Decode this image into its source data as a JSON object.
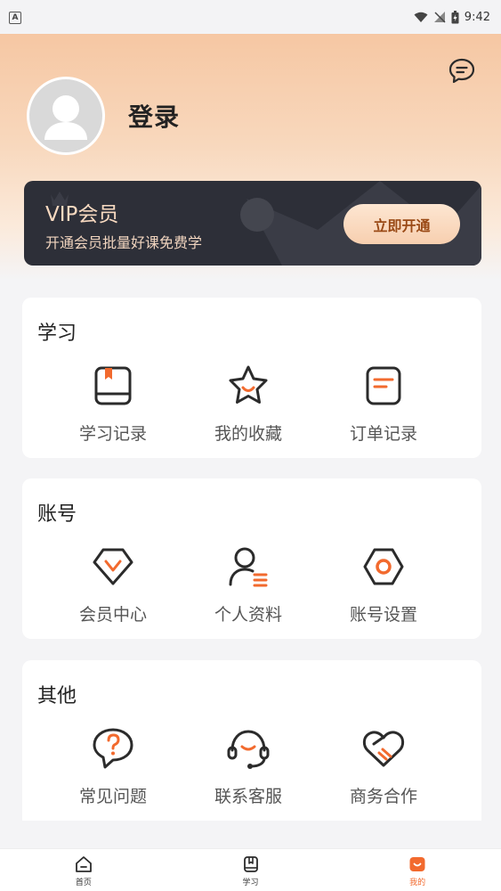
{
  "status_bar": {
    "app_badge": "A",
    "time": "9:42"
  },
  "profile": {
    "login_label": "登录"
  },
  "vip": {
    "title": "VIP会员",
    "subtitle": "开通会员批量好课免费学",
    "button": "立即开通"
  },
  "sections": [
    {
      "title": "学习",
      "items": [
        {
          "label": "学习记录",
          "icon": "book-icon"
        },
        {
          "label": "我的收藏",
          "icon": "star-icon"
        },
        {
          "label": "订单记录",
          "icon": "order-icon"
        }
      ]
    },
    {
      "title": "账号",
      "items": [
        {
          "label": "会员中心",
          "icon": "vip-diamond-icon"
        },
        {
          "label": "个人资料",
          "icon": "profile-icon"
        },
        {
          "label": "账号设置",
          "icon": "settings-hexagon-icon"
        }
      ]
    },
    {
      "title": "其他",
      "items": [
        {
          "label": "常见问题",
          "icon": "question-bubble-icon"
        },
        {
          "label": "联系客服",
          "icon": "headset-icon"
        },
        {
          "label": "商务合作",
          "icon": "handshake-heart-icon"
        }
      ]
    }
  ],
  "tabbar": {
    "tabs": [
      {
        "label": "首页",
        "icon": "home-icon",
        "active": false
      },
      {
        "label": "学习",
        "icon": "bookmark-book-icon",
        "active": false
      },
      {
        "label": "我的",
        "icon": "my-smile-icon",
        "active": true
      }
    ]
  },
  "colors": {
    "accent": "#f26a2e",
    "icon_stroke": "#2b2b2b",
    "header_gradient_top": "#f6c7a3",
    "vip_bg": "#2d2f38",
    "vip_text": "#f7d9c0"
  }
}
